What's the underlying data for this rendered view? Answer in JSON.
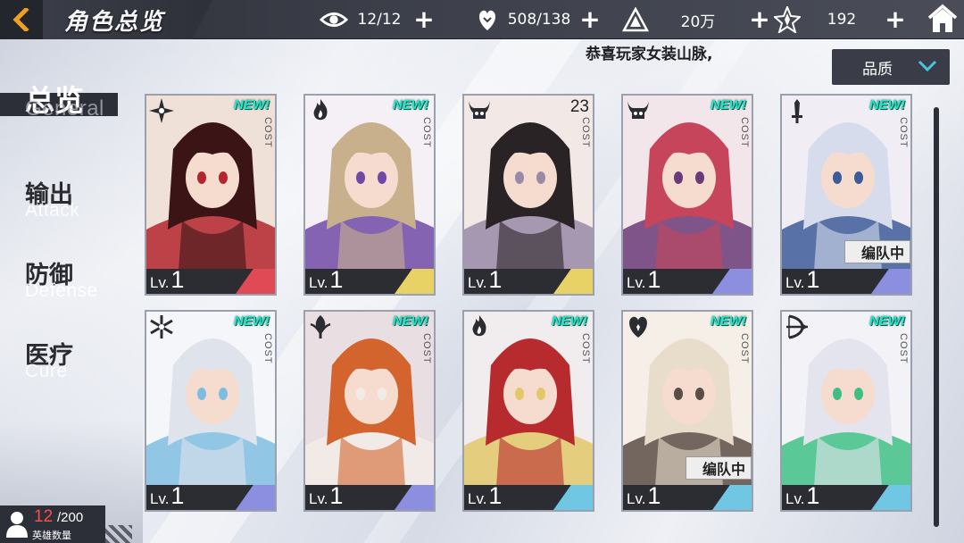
{
  "header": {
    "title": "角色总览",
    "resources": [
      {
        "icon": "eye-icon",
        "value": "12/12"
      },
      {
        "icon": "heart-hand-icon",
        "value": "508/138"
      },
      {
        "icon": "pyramid-coin-icon",
        "value": "20万"
      },
      {
        "icon": "star-shard-icon",
        "value": "192"
      }
    ]
  },
  "marquee": "恭喜玩家女装山脉,",
  "filter": {
    "label": "品质"
  },
  "nav": [
    {
      "zh": "总览",
      "en": "General",
      "active": true
    },
    {
      "zh": "输出",
      "en": "Attack",
      "active": false
    },
    {
      "zh": "防御",
      "en": "Defense",
      "active": false
    },
    {
      "zh": "医疗",
      "en": "Cure",
      "active": false
    }
  ],
  "cards": [
    {
      "badge": "shuriken-icon",
      "tag": "NEW!",
      "cost": "COST",
      "lv_label": "Lv.",
      "lv": "1",
      "accent": "#e04a55",
      "art": [
        "#3b1416",
        "#b3262e",
        "#efe0d8"
      ]
    },
    {
      "badge": "flame-icon",
      "tag": "NEW!",
      "cost": "COST",
      "lv_label": "Lv.",
      "lv": "1",
      "accent": "#e8d266",
      "art": [
        "#c9b08c",
        "#6e4aa6",
        "#f4f0f5"
      ]
    },
    {
      "badge": "horned-skull-icon",
      "tag": "23",
      "cost": "COST",
      "lv_label": "Lv.",
      "lv": "1",
      "accent": "#e8d266",
      "art": [
        "#2a2326",
        "#9a8aa8",
        "#f2e8e6"
      ]
    },
    {
      "badge": "horned-skull-icon",
      "tag": "NEW!",
      "cost": "COST",
      "lv_label": "Lv.",
      "lv": "1",
      "accent": "#8c8fe0",
      "art": [
        "#c6455a",
        "#6a3a78",
        "#f3e6ea"
      ]
    },
    {
      "badge": "sword-icon",
      "tag": "NEW!",
      "cost": "COST",
      "lv_label": "Lv.",
      "lv": "1",
      "accent": "#8c8fe0",
      "art": [
        "#d6dcec",
        "#3d5b98",
        "#f0eef4"
      ],
      "team": "编队中"
    },
    {
      "badge": "snowflake-icon",
      "tag": "NEW!",
      "cost": "COST",
      "lv_label": "Lv.",
      "lv": "1",
      "accent": "#8c8fe0",
      "art": [
        "#dfe3ec",
        "#7fbde0",
        "#f4f6fa"
      ]
    },
    {
      "badge": "leaf-icon",
      "tag": "NEW!",
      "cost": "COST",
      "lv_label": "Lv.",
      "lv": "1",
      "accent": "#8c8fe0",
      "art": [
        "#d3642e",
        "#f2ece6",
        "#e9dfe3"
      ]
    },
    {
      "badge": "flame-icon",
      "tag": "NEW!",
      "cost": "COST",
      "lv_label": "Lv.",
      "lv": "1",
      "accent": "#6fc7e3",
      "art": [
        "#b72a2e",
        "#e3c86a",
        "#f1ecee"
      ]
    },
    {
      "badge": "heart-shield-icon",
      "tag": "NEW!",
      "cost": "COST",
      "lv_label": "Lv.",
      "lv": "1",
      "accent": "#6fc7e3",
      "art": [
        "#e8dccb",
        "#5a4d45",
        "#f5efe8"
      ],
      "team": "编队中"
    },
    {
      "badge": "bow-icon",
      "tag": "NEW!",
      "cost": "COST",
      "lv_label": "Lv.",
      "lv": "1",
      "accent": "#6fc7e3",
      "art": [
        "#e4e4ee",
        "#3fbf86",
        "#f3f3f7"
      ]
    }
  ],
  "hero_count": {
    "current": "12",
    "max": "/200",
    "caption": "英雄数量"
  }
}
